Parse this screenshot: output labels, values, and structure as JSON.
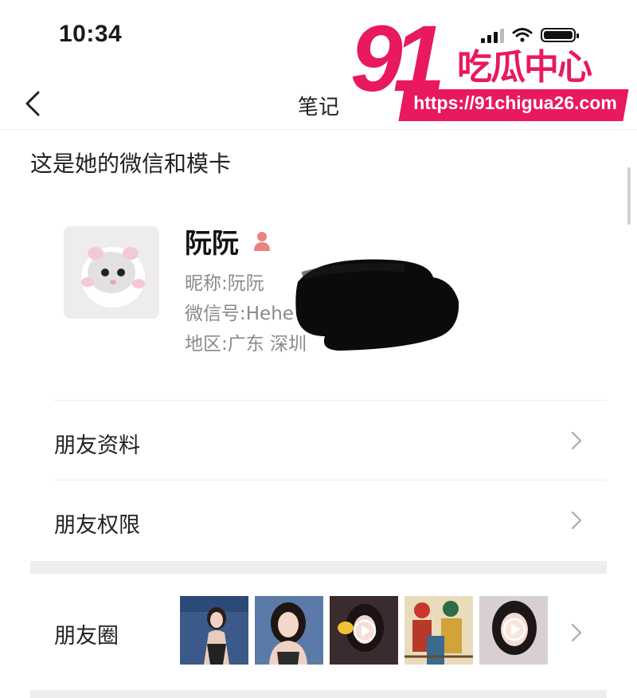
{
  "status_bar": {
    "time": "10:34"
  },
  "nav": {
    "title": "笔记"
  },
  "note": {
    "title": "这是她的微信和模卡"
  },
  "contact_card": {
    "name": "阮阮",
    "nickname": "昵称:阮阮",
    "wechat_id": "微信号:Hehe",
    "region": "地区:广东 深圳"
  },
  "rows": {
    "friend_profile": "朋友资料",
    "friend_permissions": "朋友权限",
    "moments": "朋友圈"
  },
  "watermark": {
    "logo_number": "91",
    "logo_text": "吃瓜中心",
    "url": "https://91chigua26.com"
  },
  "colors": {
    "brand": "#e8195e",
    "divider": "#ececec",
    "muted_text": "#8a8a8a"
  },
  "icons": [
    "back-icon",
    "signal-icon",
    "wifi-icon",
    "battery-icon",
    "gender-female-icon",
    "chevron-right-icon",
    "play-icon"
  ]
}
